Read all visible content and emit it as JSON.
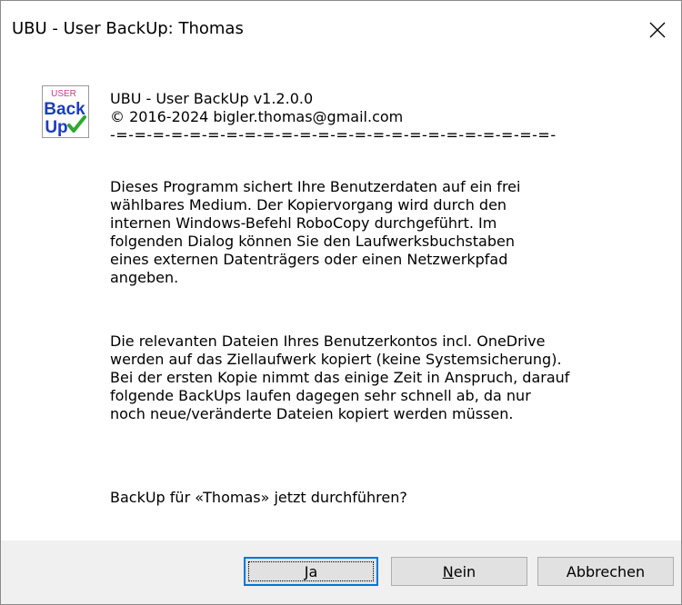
{
  "window": {
    "title": "UBU - User BackUp: Thomas"
  },
  "app_icon": {
    "name": "ubu-user-backup-icon",
    "text_top": "USER",
    "text_mid": "Back",
    "text_bottom": "Up",
    "colors": {
      "user": "#c83a8a",
      "back": "#1a3dbf",
      "check": "#2fa82f"
    }
  },
  "header": {
    "line1": "UBU - User BackUp v1.2.0.0",
    "line2": "© 2016-2024 bigler.thomas@gmail.com",
    "separator": "-=-=-=-=-=-=-=-=-=-=-=-=-=-=-=-=-=-=-=-=-=-=-=-=-"
  },
  "body": {
    "paragraph1": "Dieses Programm sichert Ihre Benutzerdaten auf ein frei\nwählbares Medium. Der Kopiervorgang wird durch den\ninternen Windows-Befehl RoboCopy durchgeführt. Im\nfolgenden Dialog können Sie den Laufwerksbuchstaben\neines externen Datenträgers oder einen Netzwerkpfad\nangeben.",
    "paragraph2": "Die relevanten Dateien Ihres Benutzerkontos incl. OneDrive\nwerden auf das Ziellaufwerk kopiert (keine Systemsicherung).\nBei der ersten Kopie nimmt das einige Zeit in Anspruch, darauf\nfolgende BackUps laufen dagegen sehr schnell ab, da nur\nnoch neue/veränderte Dateien kopiert werden müssen.",
    "question": "BackUp für «Thomas» jetzt durchführen?"
  },
  "buttons": {
    "yes": {
      "accel": "J",
      "rest": "a"
    },
    "no": {
      "accel": "N",
      "rest": "ein"
    },
    "cancel": "Abbrechen"
  },
  "accent_color": "#0078d7"
}
